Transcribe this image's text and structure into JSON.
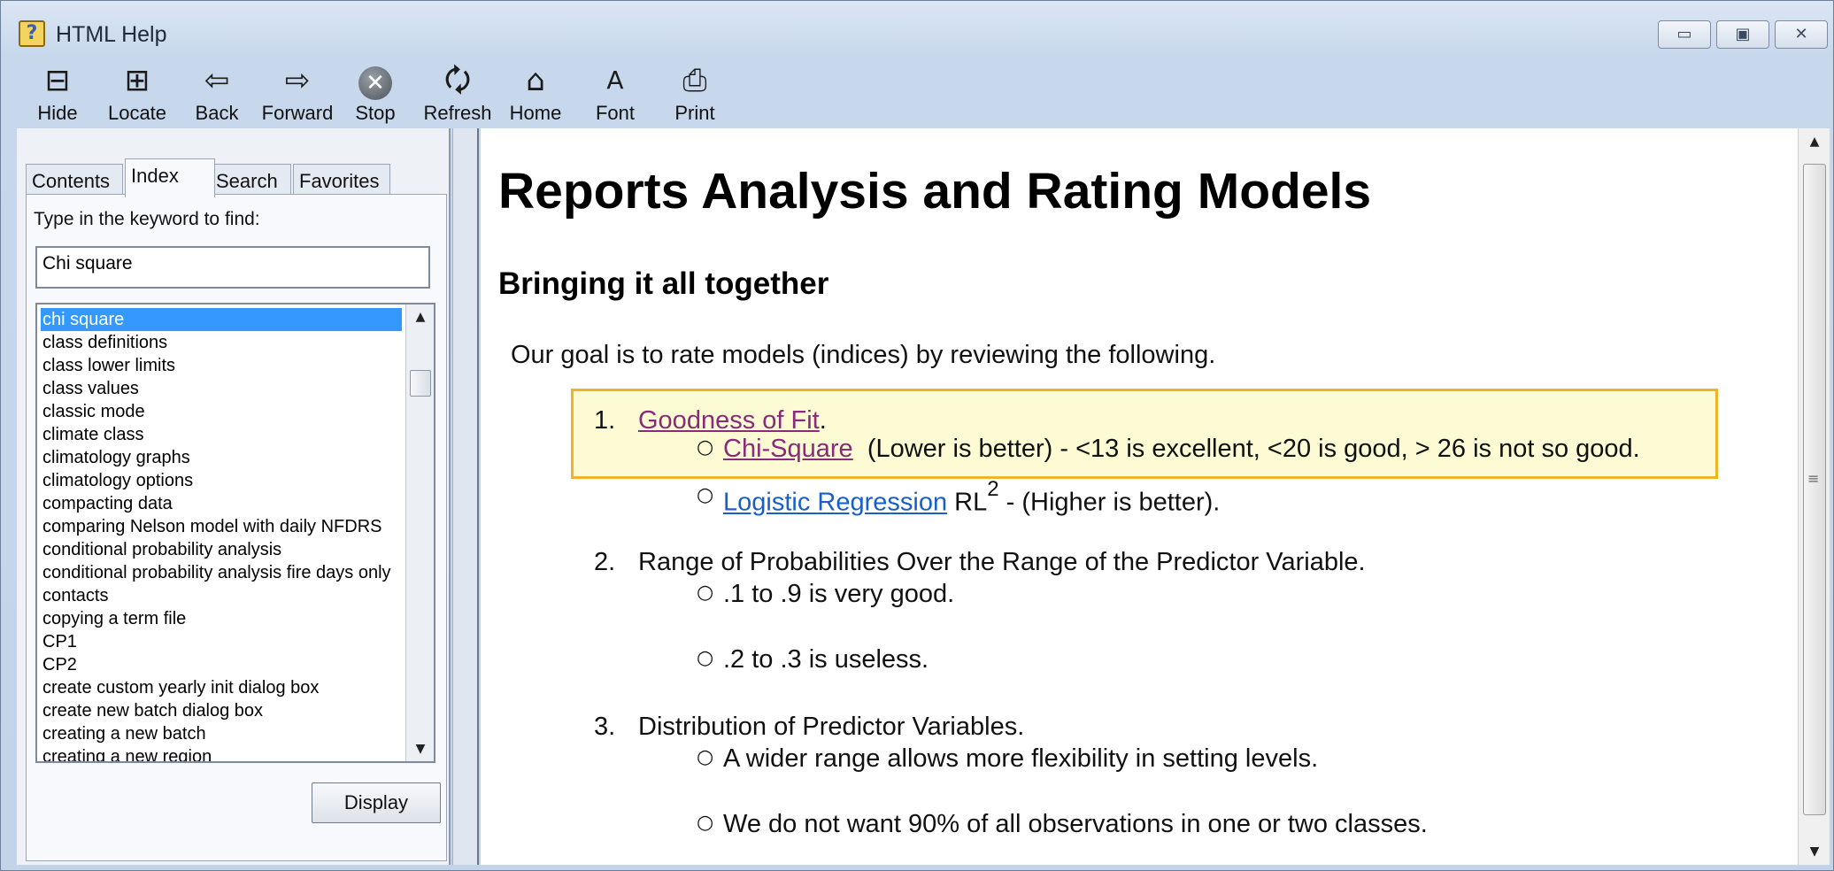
{
  "window": {
    "title": "HTML Help"
  },
  "toolbar": {
    "hide": "Hide",
    "locate": "Locate",
    "back": "Back",
    "forward": "Forward",
    "stop": "Stop",
    "refresh": "Refresh",
    "home": "Home",
    "font": "Font",
    "print": "Print"
  },
  "tabs": {
    "contents": "Contents",
    "index": "Index",
    "search": "Search",
    "favorites": "Favorites"
  },
  "index_panel": {
    "keyword_label": "Type in the keyword to find:",
    "keyword_value": "Chi square",
    "items": [
      "chi square",
      "class definitions",
      "class lower limits",
      "class values",
      "classic mode",
      "climate class",
      "climatology graphs",
      "climatology options",
      "compacting data",
      "comparing Nelson model with daily NFDRS",
      "conditional probability analysis",
      "conditional probability analysis fire days only",
      "contacts",
      "copying a term file",
      "CP1",
      "CP2",
      "create custom yearly init dialog box",
      "create new batch dialog box",
      "creating a new batch",
      "creating a new region"
    ],
    "display_button": "Display"
  },
  "content": {
    "title": "Reports Analysis and Rating Models",
    "subtitle": "Bringing it all together",
    "intro": "Our goal is to rate models (indices) by reviewing the following.",
    "item1": {
      "number": "1.",
      "link": "Goodness of Fit",
      "suffix": ".",
      "sub1_link": "Chi-Square",
      "sub1_text": "(Lower is better) - <13 is excellent, <20 is good, > 26 is not so good.",
      "sub2_link": "Logistic Regression",
      "sub2_rl": "RL",
      "sub2_sup": "2",
      "sub2_text": "- (Higher is better)."
    },
    "item2": {
      "number": "2.",
      "text": "Range of Probabilities Over the Range of the Predictor Variable.",
      "sub1": ".1 to .9 is very good.",
      "sub2": ".2 to .3 is useless."
    },
    "item3": {
      "number": "3.",
      "text": "Distribution of Predictor Variables.",
      "sub1": "A wider range allows more flexibility in setting levels.",
      "sub2": "We do not want 90% of all observations in one or two classes."
    }
  },
  "colors": {
    "highlight_border": "#f0b429",
    "highlight_bg": "#fdfbd4",
    "selection": "#3399ff",
    "visited_link": "#8a2a7a",
    "link": "#1860c8"
  }
}
